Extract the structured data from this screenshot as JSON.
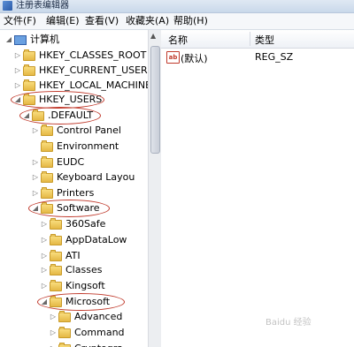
{
  "window": {
    "title": "注册表编辑器"
  },
  "menu": [
    "文件(F)",
    "编辑(E)",
    "查看(V)",
    "收藏夹(A)",
    "帮助(H)"
  ],
  "tree": [
    {
      "label": "计算机",
      "icon": "computer-icon",
      "expanded": true
    },
    {
      "label": "HKEY_CLASSES_ROOT",
      "icon": "folder-icon",
      "expanded": false
    },
    {
      "label": "HKEY_CURRENT_USER",
      "icon": "folder-icon",
      "expanded": false
    },
    {
      "label": "HKEY_LOCAL_MACHINE",
      "icon": "folder-icon",
      "expanded": false
    },
    {
      "label": "HKEY_USERS",
      "icon": "folder-icon",
      "expanded": true,
      "circled": true
    },
    {
      "label": ".DEFAULT",
      "icon": "folder-icon",
      "expanded": true,
      "circled": true
    },
    {
      "label": "Control Panel",
      "icon": "folder-icon",
      "expanded": false
    },
    {
      "label": "Environment",
      "icon": "folder-icon",
      "expanded": null
    },
    {
      "label": "EUDC",
      "icon": "folder-icon",
      "expanded": false
    },
    {
      "label": "Keyboard Layou",
      "icon": "folder-icon",
      "expanded": false
    },
    {
      "label": "Printers",
      "icon": "folder-icon",
      "expanded": false
    },
    {
      "label": "Software",
      "icon": "folder-icon",
      "expanded": true,
      "circled": true
    },
    {
      "label": "360Safe",
      "icon": "folder-icon",
      "expanded": false
    },
    {
      "label": "AppDataLow",
      "icon": "folder-icon",
      "expanded": false
    },
    {
      "label": "ATI",
      "icon": "folder-icon",
      "expanded": false
    },
    {
      "label": "Classes",
      "icon": "folder-icon",
      "expanded": false
    },
    {
      "label": "Kingsoft",
      "icon": "folder-icon",
      "expanded": false
    },
    {
      "label": "Microsoft",
      "icon": "folder-icon",
      "expanded": true,
      "circled": true
    },
    {
      "label": "Advanced",
      "icon": "folder-icon",
      "expanded": false
    },
    {
      "label": "Command",
      "icon": "folder-icon",
      "expanded": false
    },
    {
      "label": "Cryptogra",
      "icon": "folder-icon",
      "expanded": false
    }
  ],
  "list": {
    "columns": {
      "name": "名称",
      "type": "类型"
    },
    "rows": [
      {
        "icon": "string-value-icon",
        "icon_text": "ab",
        "name": "(默认)",
        "type": "REG_SZ"
      }
    ]
  },
  "watermark": "Baidu 经验",
  "colors": {
    "annotation": "#c0392b",
    "folder": "#e5b845"
  }
}
